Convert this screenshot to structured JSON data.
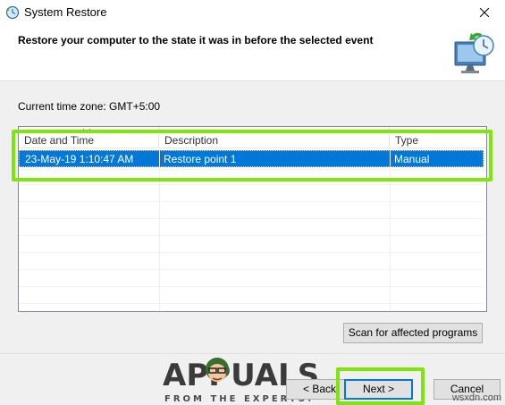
{
  "window": {
    "title": "System Restore",
    "close_glyph": "✕"
  },
  "header": {
    "title": "Restore your computer to the state it was in before the selected event",
    "icon": "system-restore-monitor-icon"
  },
  "timezone": {
    "label": "Current time zone: GMT+5:00"
  },
  "list": {
    "columns": [
      "Date and Time",
      "Description",
      "Type"
    ],
    "rows": [
      {
        "date": "23-May-19 1:10:47 AM",
        "description": "Restore point 1",
        "type": "Manual",
        "selected": true
      }
    ]
  },
  "buttons": {
    "scan": "Scan for affected programs",
    "back": "< Back",
    "next": "Next >",
    "cancel": "Cancel"
  },
  "watermark": {
    "brand": "APPUALS",
    "tagline": "FROM THE EXPERTS!",
    "site": "wsxdn.com"
  },
  "colors": {
    "highlight": "#7ee60b",
    "selection": "#0078d7"
  }
}
